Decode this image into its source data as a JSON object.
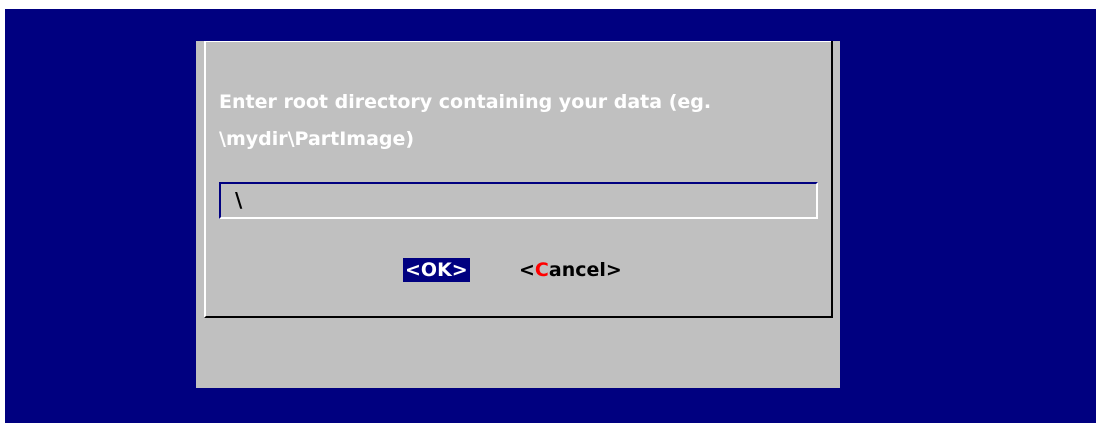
{
  "dialog": {
    "prompt": "Enter root directory containing your data (eg.\n\\mydir\\PartImage)",
    "input_value": "\\",
    "ok_label": "<OK>",
    "cancel": {
      "open": "<",
      "hotkey": "C",
      "rest": "ancel>"
    }
  },
  "colors": {
    "background": "#000080",
    "dialog": "#c0c0c0",
    "hotkey": "#ff0000"
  }
}
